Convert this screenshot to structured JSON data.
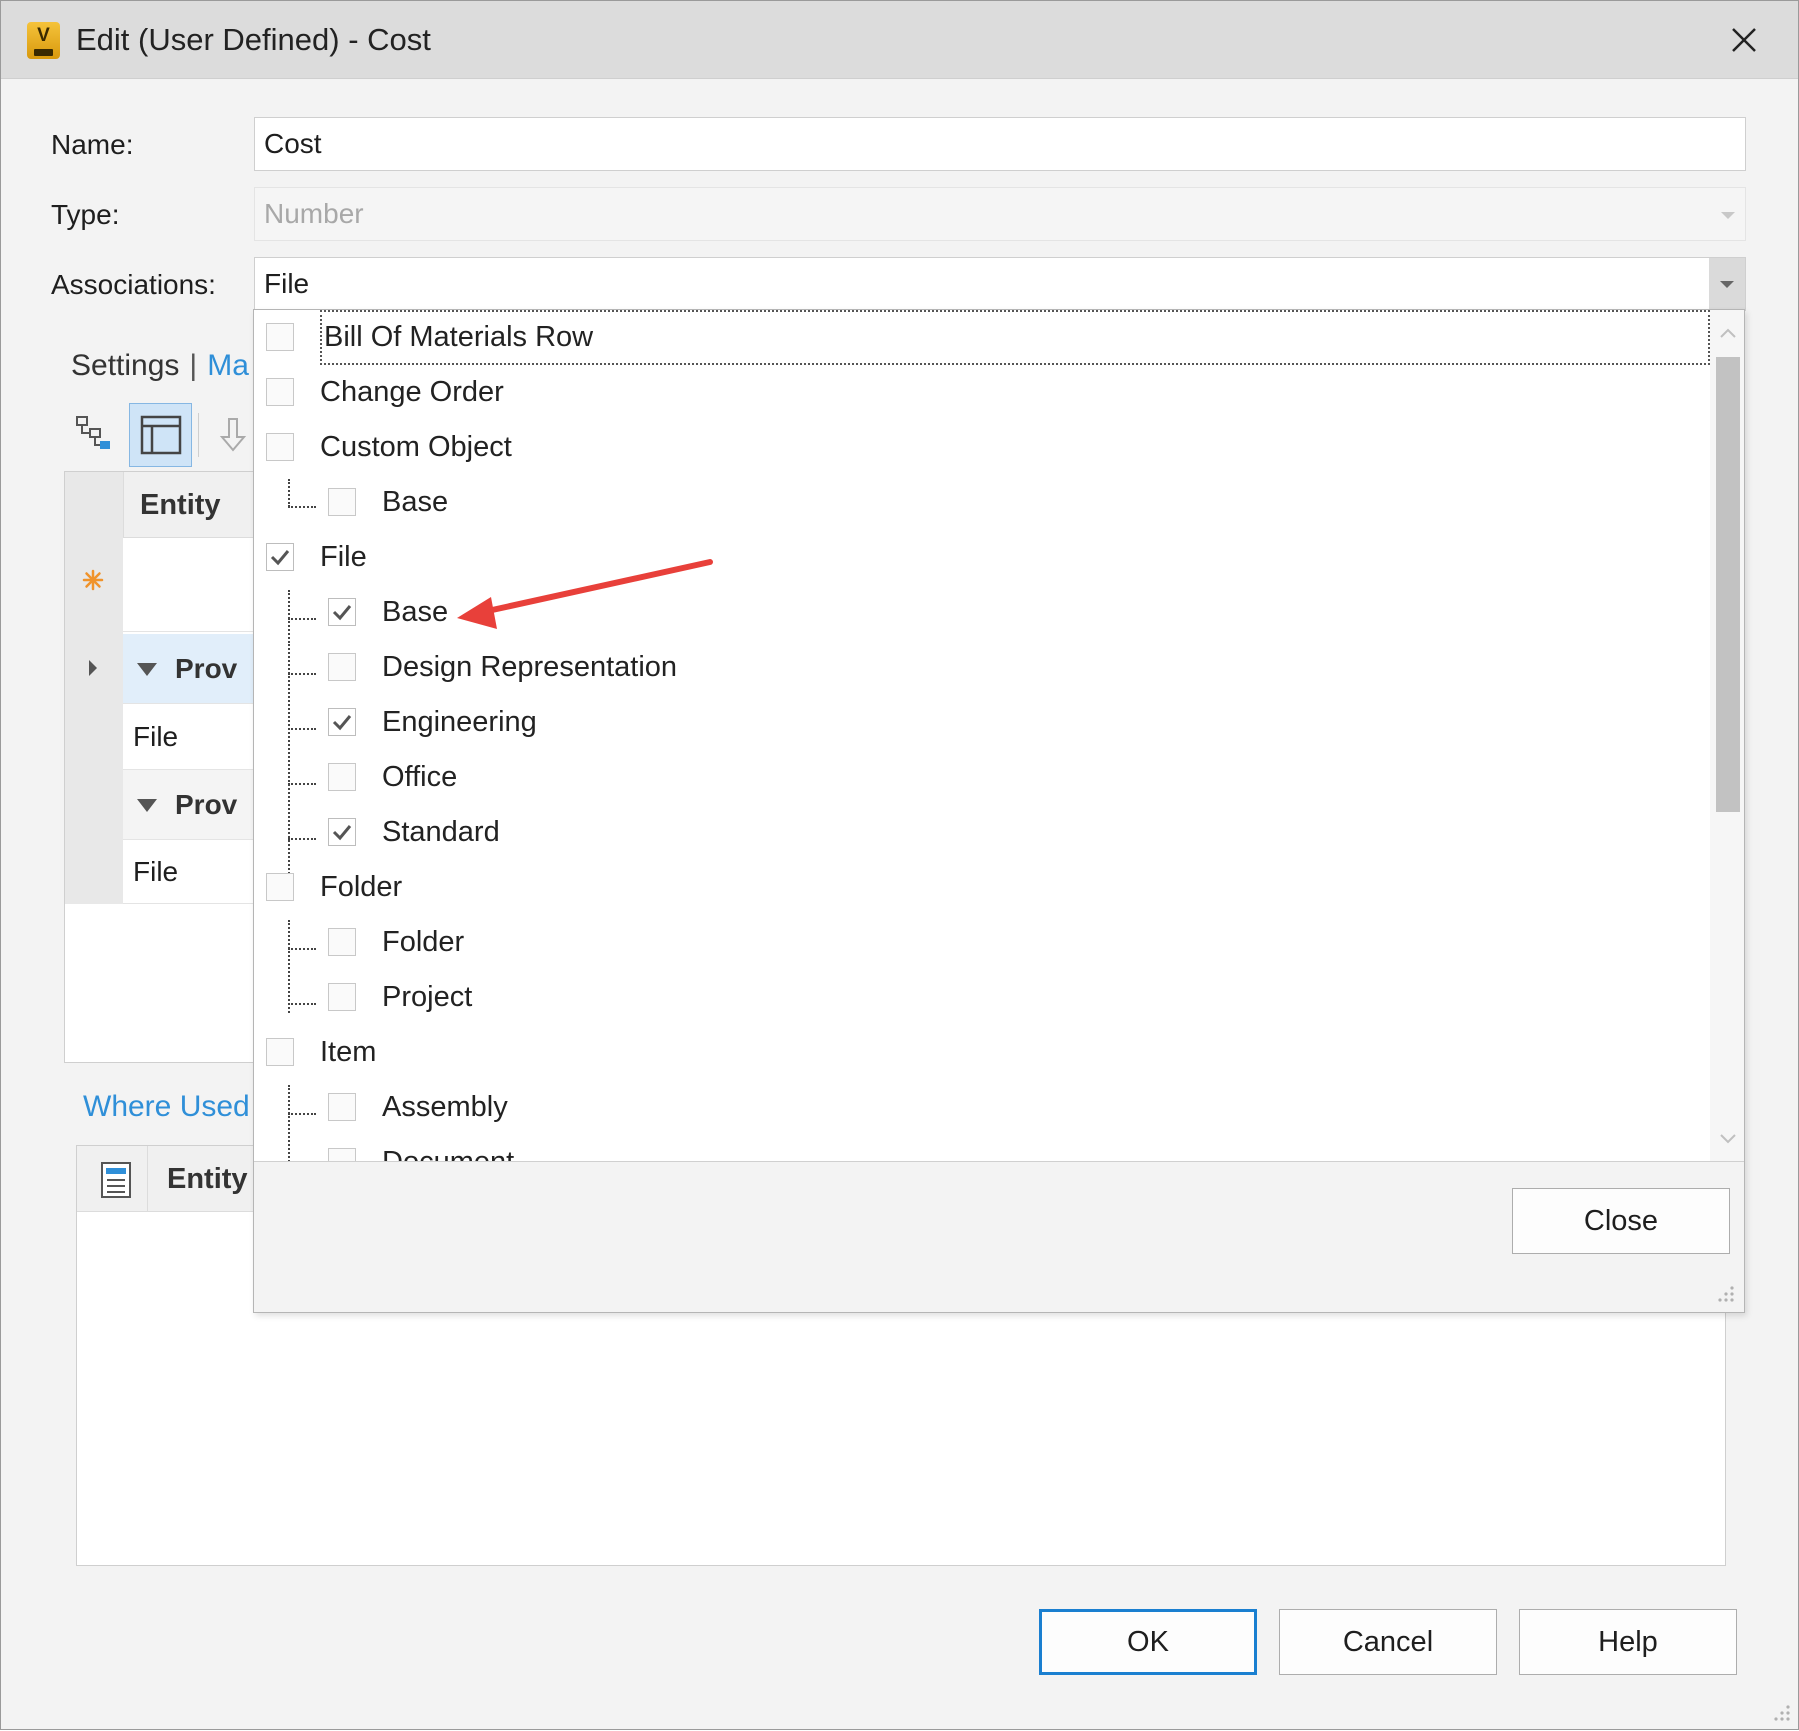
{
  "window": {
    "title": "Edit (User Defined) - Cost",
    "app_icon_letter": "V"
  },
  "form": {
    "name_label": "Name:",
    "name_value": "Cost",
    "type_label": "Type:",
    "type_value": "Number",
    "associations_label": "Associations:",
    "associations_value": "File"
  },
  "tabs": {
    "settings": "Settings",
    "separator": "|",
    "mapping_partial": "Ma"
  },
  "mapping_grid": {
    "header": "Entity",
    "group1_label": "Prov",
    "row1_value": "File",
    "group2_label": "Prov",
    "row2_value": "File"
  },
  "where_used": {
    "link": "Where Used",
    "header": "Entity"
  },
  "buttons": {
    "ok": "OK",
    "cancel": "Cancel",
    "help": "Help"
  },
  "popup": {
    "close_label": "Close",
    "items": [
      {
        "label": "Bill Of Materials Row",
        "level": 0,
        "checked": false
      },
      {
        "label": "Change Order",
        "level": 0,
        "checked": false
      },
      {
        "label": "Custom Object",
        "level": 0,
        "checked": false
      },
      {
        "label": "Base",
        "level": 1,
        "checked": false
      },
      {
        "label": "File",
        "level": 0,
        "checked": true
      },
      {
        "label": "Base",
        "level": 1,
        "checked": true
      },
      {
        "label": "Design Representation",
        "level": 1,
        "checked": false
      },
      {
        "label": "Engineering",
        "level": 1,
        "checked": true
      },
      {
        "label": "Office",
        "level": 1,
        "checked": false
      },
      {
        "label": "Standard",
        "level": 1,
        "checked": true
      },
      {
        "label": "Folder",
        "level": 0,
        "checked": false
      },
      {
        "label": "Folder",
        "level": 1,
        "checked": false
      },
      {
        "label": "Project",
        "level": 1,
        "checked": false
      },
      {
        "label": "Item",
        "level": 0,
        "checked": false
      },
      {
        "label": "Assembly",
        "level": 1,
        "checked": false
      },
      {
        "label": "Document",
        "level": 1,
        "checked": false
      }
    ]
  },
  "colors": {
    "link": "#2f8fd8",
    "default_button_border": "#1a7fd0",
    "arrow": "#e8403a",
    "selected_row": "#e1eefa"
  }
}
